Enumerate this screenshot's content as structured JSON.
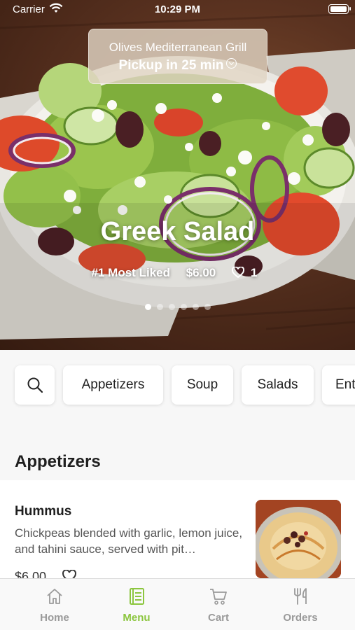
{
  "status_bar": {
    "carrier": "Carrier",
    "time": "10:29 PM"
  },
  "restaurant": {
    "name": "Olives Mediterranean Grill",
    "pickup": "Pickup in 25 min"
  },
  "featured": {
    "title": "Greek Salad",
    "rank": "#1 Most Liked",
    "price": "$6.00",
    "likes": "1",
    "slide_count": 6,
    "active_slide": 1
  },
  "categories": [
    "Appetizers",
    "Soup",
    "Salads",
    "Ent"
  ],
  "section": {
    "title": "Appetizers"
  },
  "items": [
    {
      "name": "Hummus",
      "description": "Chickpeas blended with garlic, lemon juice, and tahini sauce, served with pit…",
      "price": "$6.00"
    }
  ],
  "tabs": [
    {
      "label": "Home",
      "icon": "home-icon"
    },
    {
      "label": "Menu",
      "icon": "menu-book-icon",
      "active": true
    },
    {
      "label": "Cart",
      "icon": "cart-icon"
    },
    {
      "label": "Orders",
      "icon": "fork-knife-icon"
    }
  ],
  "colors": {
    "accent": "#8cc63f",
    "inactive": "#9a9a9a"
  }
}
